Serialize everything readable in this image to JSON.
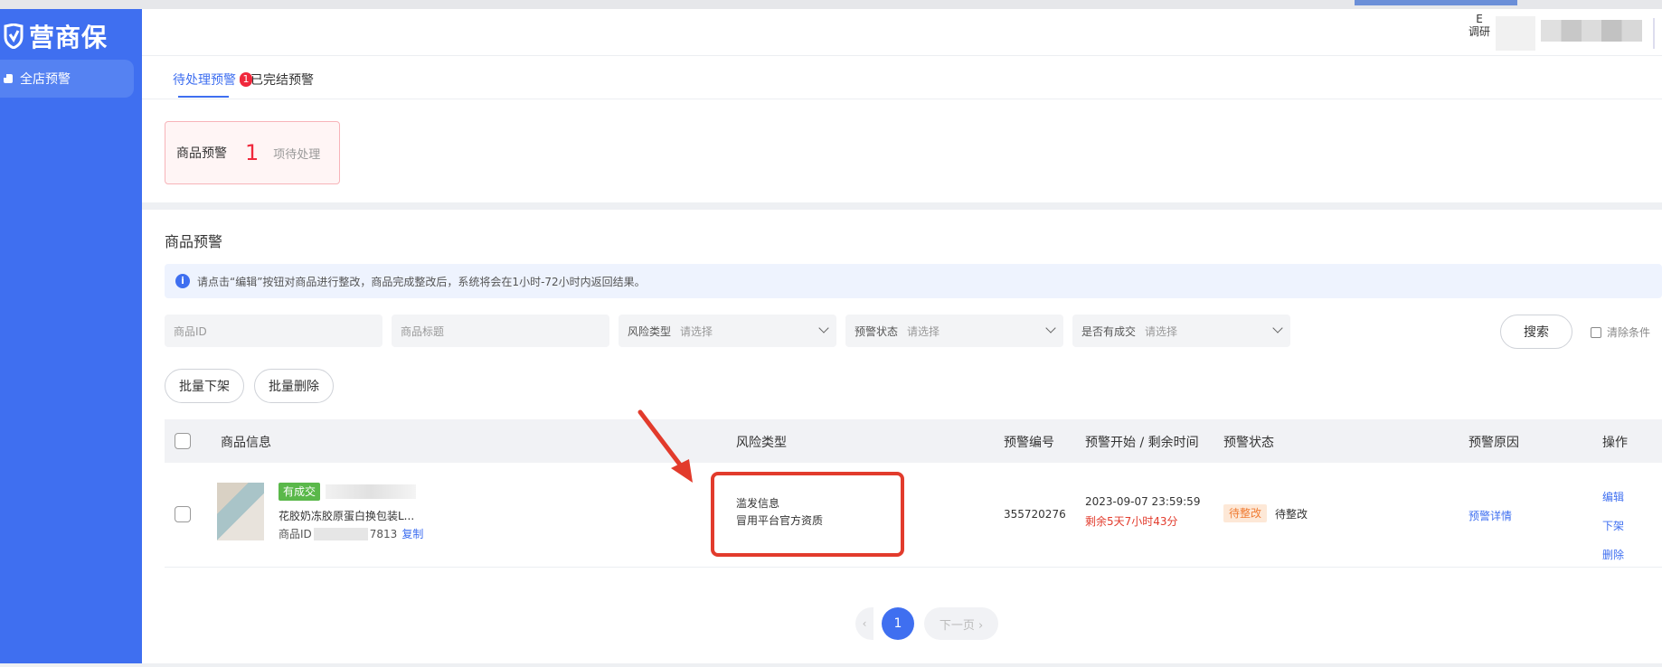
{
  "app": {
    "logo_text": "营商保",
    "nav": [
      {
        "label": "全店预警"
      }
    ]
  },
  "header": {
    "user_small_line1": "E",
    "user_small_line2": "调研"
  },
  "tabs": [
    {
      "label": "待处理预警",
      "badge": "1"
    },
    {
      "label": "已完结预警"
    }
  ],
  "summary": {
    "label": "商品预警",
    "count": "1",
    "suffix": "项待处理"
  },
  "list": {
    "title": "商品预警",
    "info": "请点击“编辑”按钮对商品进行整改，商品完成整改后，系统将会在1小时-72小时内返回结果。",
    "filters": {
      "product_id_placeholder": "商品ID",
      "product_title_placeholder": "商品标题",
      "risk_type_label": "风险类型",
      "risk_type_value": "请选择",
      "warn_status_label": "预警状态",
      "warn_status_value": "请选择",
      "has_deal_label": "是否有成交",
      "has_deal_value": "请选择"
    },
    "search_label": "搜索",
    "clear_label": "清除条件",
    "batch_down_label": "批量下架",
    "batch_delete_label": "批量删除",
    "columns": [
      "商品信息",
      "风险类型",
      "预警编号",
      "预警开始 / 剩余时间",
      "预警状态",
      "预警原因",
      "操作"
    ],
    "rows": [
      {
        "tag": "有成交",
        "title": "花胶奶冻胶原蛋白换包装L...",
        "id_prefix": "商品ID",
        "id_suffix": "7813",
        "copy_label": "复制",
        "risk_line1": "滥发信息",
        "risk_line2": "冒用平台官方资质",
        "warn_no": "355720276",
        "start_time": "2023-09-07 23:59:59",
        "remaining": "剩余5天7小时43分",
        "status_tag": "待整改",
        "status_text": "待整改",
        "reason_link": "预警详情",
        "ops": [
          "编辑",
          "下架",
          "删除"
        ]
      }
    ]
  },
  "pagination": {
    "prev": "‹",
    "current": "1",
    "next": "下一页 ›"
  },
  "colors": {
    "sidebar": "#3f6ff0",
    "accent": "#3f6ff0",
    "danger": "#f0283c",
    "annotation": "#e23b2c"
  }
}
